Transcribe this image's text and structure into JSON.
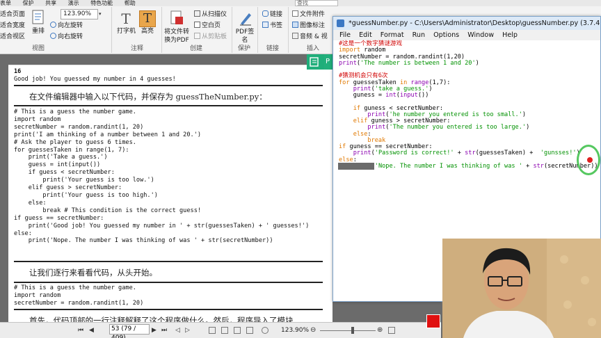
{
  "ribbon": {
    "menu": [
      "表单",
      "保护",
      "共享",
      "演示",
      "特色功能",
      "帮助"
    ],
    "search_placeholder": "查找",
    "view_items": [
      "适合页面",
      "适合宽度",
      "适合视区"
    ],
    "reflow_label": "重排",
    "zoom_value": "123.90%",
    "rotate_left": "向左旋转",
    "rotate_right": "向右旋转",
    "group_view": "视图",
    "typewriter_label": "打字机",
    "highlight_label": "高亮",
    "group_comment": "注释",
    "convert_label": "将文件转换为PDF",
    "scanner_label": "从扫描仪",
    "blank_page_label": "空白页",
    "clipboard_label": "从剪贴板",
    "group_create": "创建",
    "pdf_sign_label": "PDF签名",
    "group_protect": "保护",
    "link_label": "链接",
    "bookmark_label": "书签",
    "group_link": "链接",
    "file_attach_label": "文件附件",
    "image_annot_label": "图像标注",
    "audio_label": "音频 & 视",
    "group_insert": "插入"
  },
  "doc": {
    "page_number": "16",
    "output_line": "Good job! You guessed my number in 4 guesses!",
    "instruction1": "在文件编辑器中输入以下代码，并保存为 guessTheNumber.py：",
    "code_block": [
      "# This is a guess the number game.",
      "import random",
      "secretNumber = random.randint(1, 20)",
      "print('I am thinking of a number between 1 and 20.')",
      "",
      "# Ask the player to guess 6 times.",
      "for guessesTaken in range(1, 7):",
      "    print('Take a guess.')",
      "    guess = int(input())",
      "",
      "    if guess < secretNumber:",
      "        print('Your guess is too low.')",
      "    elif guess > secretNumber:",
      "        print('Your guess is too high.')",
      "    else:",
      "        break # This condition is the correct guess!",
      "if guess == secretNumber:",
      "    print('Good job! You guessed my number in ' + str(guessesTaken) + ' guesses!')",
      "else:",
      "    print('Nope. The number I was thinking of was ' + str(secretNumber))"
    ],
    "instruction2": "让我们逐行来看看代码，从头开始。",
    "code_block2": [
      "# This is a guess the number game.",
      "import random",
      "secretNumber = random.randint(1, 20)"
    ],
    "partial_text": "首先，代码顶部的一行注释解释了这个程序做什么。然后，程序导入了模块"
  },
  "status": {
    "page_indicator": "53 (79 / 409)",
    "zoom": "123.90%"
  },
  "green_tab_label": "P",
  "idle": {
    "title": "*guessNumber.py - C:\\Users\\Administrator\\Desktop\\guessNumber.py (3.7.4)*",
    "menu": [
      "File",
      "Edit",
      "Format",
      "Run",
      "Options",
      "Window",
      "Help"
    ],
    "code": {
      "l1": "#这是一个数字猜谜游戏",
      "l2a": "import",
      "l2b": " random",
      "l3a": "secretNumber = random.randint(1,20)",
      "l4a": "print",
      "l4b": "(",
      "l4c": "'The number is between 1 and 20'",
      "l4d": ")",
      "l6": "#猜测机会只有6次",
      "l7a": "for",
      "l7b": " guessesTaken ",
      "l7c": "in",
      "l7d": " ",
      "l7e": "range",
      "l7f": "(1,7):",
      "l8a": "    ",
      "l8b": "print",
      "l8c": "(",
      "l8d": "'take a guess.'",
      "l8e": ")",
      "l9a": "    guness = ",
      "l9b": "int",
      "l9c": "(",
      "l9d": "input",
      "l9e": "())",
      "l11a": "    ",
      "l11b": "if",
      "l11c": " guness < secretNumber:",
      "l12a": "        ",
      "l12b": "print",
      "l12c": "(",
      "l12d": "'he number you entered is too small.'",
      "l12e": ")",
      "l13a": "    ",
      "l13b": "elif",
      "l13c": " guness > secretNumber:",
      "l14a": "        ",
      "l14b": "print",
      "l14c": "(",
      "l14d": "'The number you entered is too large.'",
      "l14e": ")",
      "l15a": "    ",
      "l15b": "else",
      "l15c": ":",
      "l16a": "        ",
      "l16b": "break",
      "l17a": "if",
      "l17b": " guness == secretNumber:",
      "l18a": "    ",
      "l18b": "print",
      "l18c": "(",
      "l18d": "'Password is correct!'",
      "l18e": " + ",
      "l18f": "str",
      "l18g": "(guessesTaken) +  ",
      "l18h": "'gunsses!'",
      "l18i": ")",
      "l19a": "else",
      "l19b": ":",
      "l20a": "    ",
      "l20b": "print",
      "l20c": "(",
      "l20d": "'Nope. The number I was thinking of was '",
      "l20e": " + ",
      "l20f": "str",
      "l20g": "(secretNumber))"
    }
  }
}
